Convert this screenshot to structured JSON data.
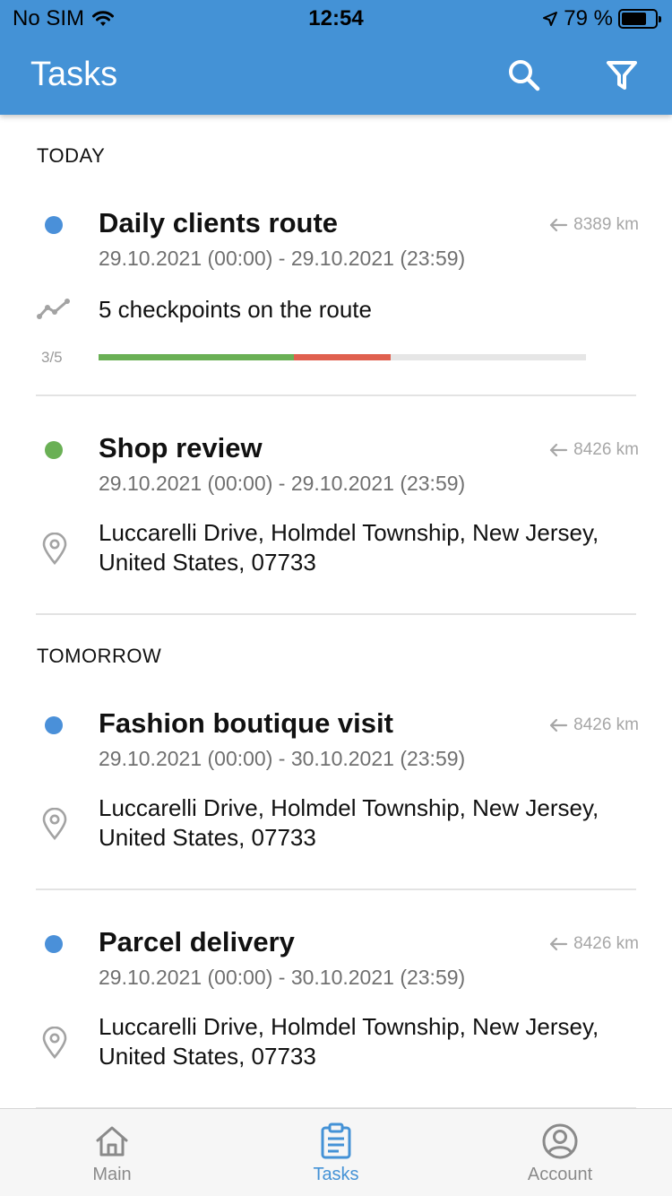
{
  "status_bar": {
    "carrier": "No SIM",
    "time": "12:54",
    "battery": "79 %"
  },
  "header": {
    "title": "Tasks",
    "search_icon": "search-icon",
    "filter_icon": "filter-icon",
    "color": "#4492d6"
  },
  "sections": [
    {
      "title": "TODAY"
    },
    {
      "title": "TOMORROW"
    }
  ],
  "tasks": [
    {
      "title": "Daily clients route",
      "dates": "29.10.2021 (00:00) - 29.10.2021 (23:59)",
      "distance": "8389 km",
      "status_color": "#4a90d9",
      "detail": "5 checkpoints on the route",
      "detail_icon": "route-icon",
      "progress_label": "3/5",
      "progress": {
        "completed": 0.4,
        "failed": 0.2,
        "completed_color": "#6ab055",
        "failed_color": "#e0604f"
      }
    },
    {
      "title": "Shop review",
      "dates": "29.10.2021 (00:00) - 29.10.2021 (23:59)",
      "distance": "8426 km",
      "status_color": "#6ab055",
      "detail": "Luccarelli Drive, Holmdel Township, New Jersey, United States, 07733",
      "detail_icon": "location-pin-icon"
    },
    {
      "title": "Fashion boutique visit",
      "dates": "29.10.2021 (00:00) - 30.10.2021 (23:59)",
      "distance": "8426 km",
      "status_color": "#4a90d9",
      "detail": "Luccarelli Drive, Holmdel Township, New Jersey, United States, 07733",
      "detail_icon": "location-pin-icon"
    },
    {
      "title": "Parcel delivery",
      "dates": "29.10.2021 (00:00) - 30.10.2021 (23:59)",
      "distance": "8426 km",
      "status_color": "#4a90d9",
      "detail": "Luccarelli Drive, Holmdel Township, New Jersey, United States, 07733",
      "detail_icon": "location-pin-icon"
    }
  ],
  "tabbar": {
    "items": [
      {
        "label": "Main",
        "icon": "home-icon",
        "active": false
      },
      {
        "label": "Tasks",
        "icon": "clipboard-icon",
        "active": true
      },
      {
        "label": "Account",
        "icon": "account-icon",
        "active": false
      }
    ],
    "active_color": "#4492d6"
  }
}
